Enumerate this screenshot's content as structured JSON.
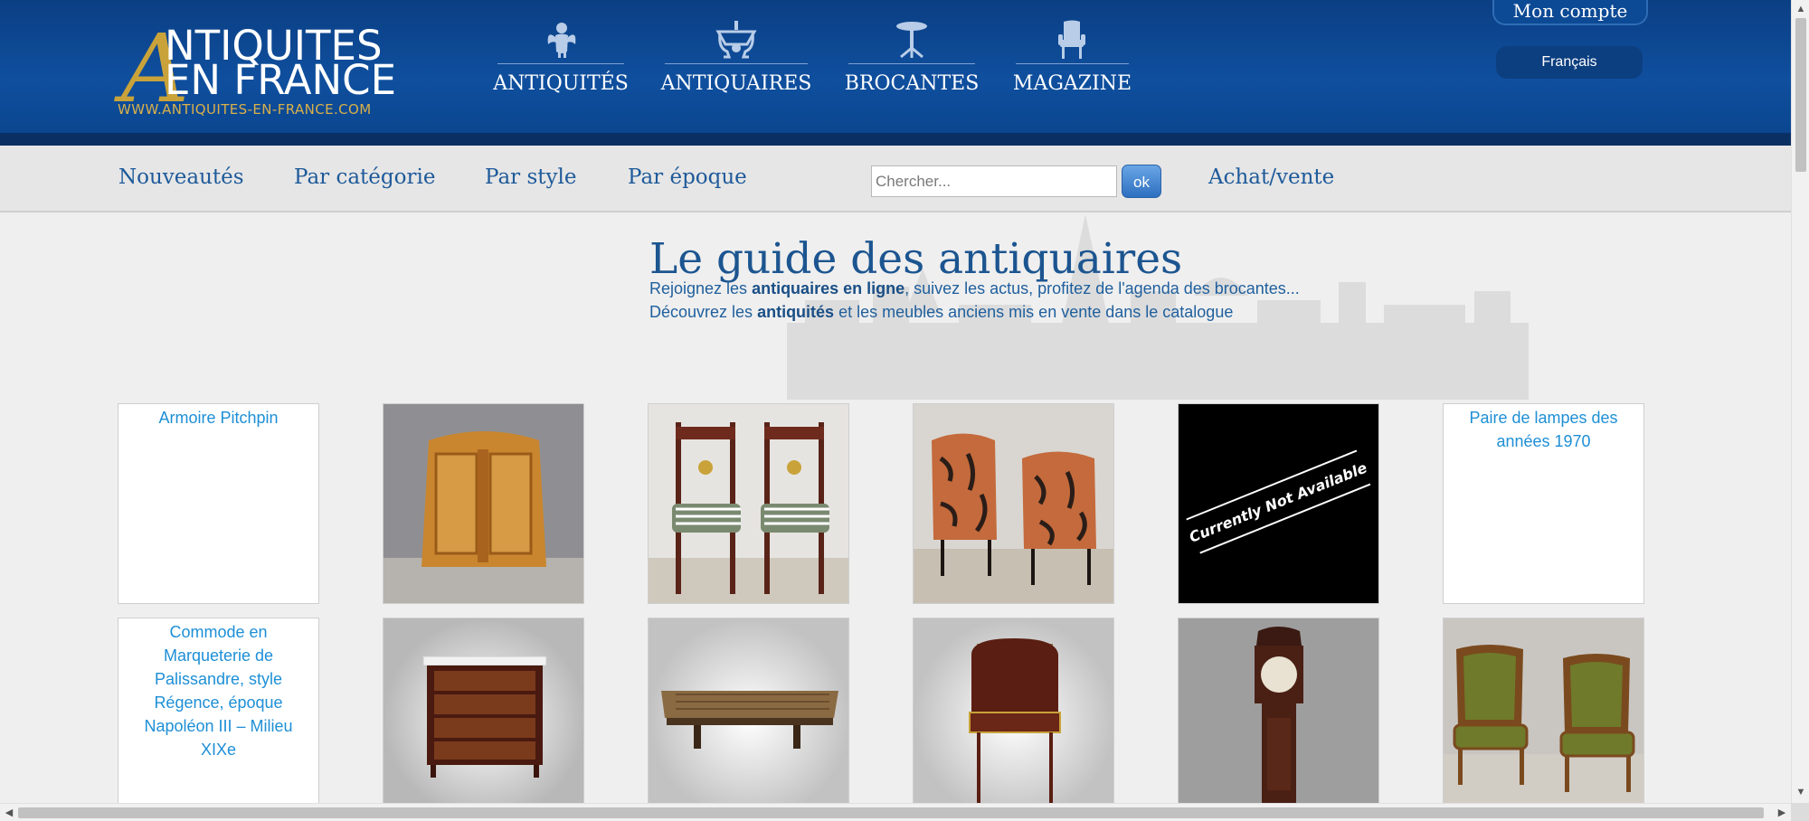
{
  "header": {
    "logo": {
      "line1": "NTIQUITES",
      "big_letter": "A",
      "line2": "EN FRANCE",
      "url": "WWW.ANTIQUITES-EN-FRANCE.COM"
    },
    "nav": [
      {
        "label": "ANTIQUITÉS",
        "icon": "cherub-icon"
      },
      {
        "label": "ANTIQUAIRES",
        "icon": "chandelier-icon"
      },
      {
        "label": "BROCANTES",
        "icon": "pedestal-table-icon"
      },
      {
        "label": "MAGAZINE",
        "icon": "armchair-icon"
      }
    ],
    "account_label": "Mon compte",
    "language_label": "Français"
  },
  "subnav": {
    "links": [
      "Nouveautés",
      "Par catégorie",
      "Par style",
      "Par époque"
    ],
    "search_placeholder": "Chercher...",
    "search_button": "ok",
    "achat_vente": "Achat/vente"
  },
  "intro": {
    "title": "Le guide des antiquaires",
    "line1_pre": "Rejoignez les ",
    "line1_bold": "antiquaires en ligne",
    "line1_post": ", suivez les actus, profitez de l'agenda des brocantes...",
    "line2_pre": "Découvrez les ",
    "line2_bold": "antiquités",
    "line2_post": " et les meubles anciens mis en vente dans le catalogue"
  },
  "products": [
    {
      "alt": "Armoire Pitchpin",
      "image": "broken"
    },
    {
      "alt": "",
      "image": "pine-armoire"
    },
    {
      "alt": "",
      "image": "striped-chairs"
    },
    {
      "alt": "",
      "image": "tiger-armchairs"
    },
    {
      "alt": "",
      "image": "not-available",
      "overlay_text": "Currently Not Available"
    },
    {
      "alt": "Paire de lampes des années 1970",
      "image": "broken"
    },
    {
      "alt": "Commode en Marqueterie de Palissandre, style Régence, époque Napoléon III – Milieu XIXe",
      "image": "broken"
    },
    {
      "alt": "",
      "image": "marble-commode"
    },
    {
      "alt": "",
      "image": "coffee-table"
    },
    {
      "alt": "",
      "image": "roll-top-desk"
    },
    {
      "alt": "",
      "image": "longcase-clock"
    },
    {
      "alt": "",
      "image": "green-armchairs"
    }
  ],
  "colors": {
    "header_blue": "#0f4f9e",
    "link_blue": "#1e5a9a",
    "gold": "#c9a33a"
  }
}
